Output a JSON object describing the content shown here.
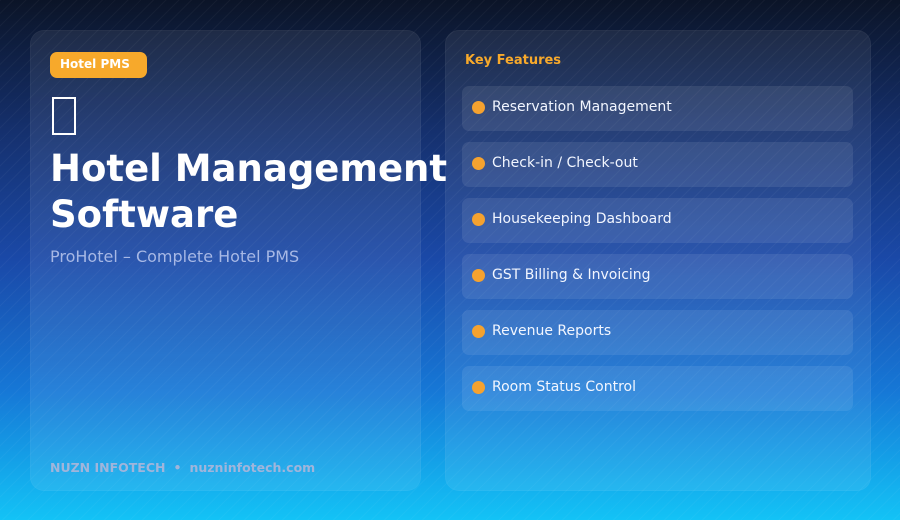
{
  "left_panel": {
    "badge": "Hotel PMS",
    "title_line1": "Hotel Management",
    "title_line2": "Software",
    "subtitle": "ProHotel – Complete Hotel PMS",
    "footer_brand": "NUZN INFOTECH",
    "footer_separator": "•",
    "footer_site": "nuzninfotech.com"
  },
  "right_panel": {
    "heading": "Key Features",
    "features": [
      {
        "label": "Reservation Management"
      },
      {
        "label": "Check-in / Check-out"
      },
      {
        "label": "Housekeeping Dashboard"
      },
      {
        "label": "GST Billing & Invoicing"
      },
      {
        "label": "Revenue Reports"
      },
      {
        "label": "Room Status Control"
      }
    ]
  },
  "colors": {
    "accent": "#f7a92b",
    "title": "#ffffff",
    "subtitle": "#a7b8e5"
  },
  "icons": {
    "hotel": "hotel-icon",
    "bullet": "bullet-dot-icon"
  }
}
